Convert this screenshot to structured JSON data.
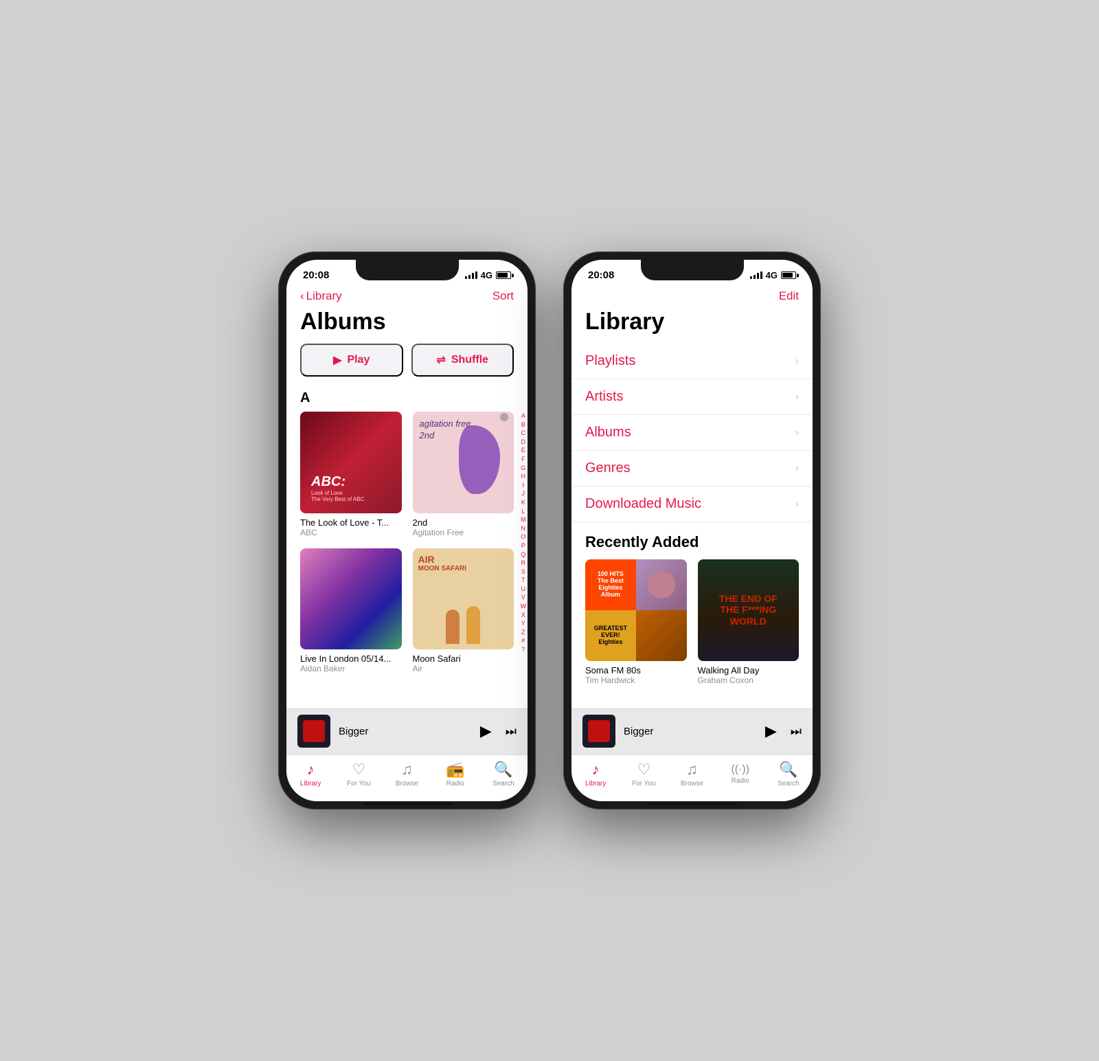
{
  "phone1": {
    "status": {
      "time": "20:08",
      "signal": "4G"
    },
    "nav": {
      "back_label": "Library",
      "action_label": "Sort"
    },
    "title": "Albums",
    "buttons": {
      "play": "Play",
      "shuffle": "Shuffle"
    },
    "section_a": "A",
    "albums": [
      {
        "title": "The Look of Love - T...",
        "artist": "ABC",
        "art_type": "abc"
      },
      {
        "title": "2nd",
        "artist": "Agitation Free",
        "art_type": "agitation"
      },
      {
        "title": "Live In London 05/14...",
        "artist": "Aidan Baker",
        "art_type": "london"
      },
      {
        "title": "Moon Safari",
        "artist": "Air",
        "art_type": "moon"
      }
    ],
    "alphabet": [
      "A",
      "B",
      "C",
      "D",
      "E",
      "F",
      "G",
      "H",
      "I",
      "J",
      "K",
      "L",
      "M",
      "N",
      "O",
      "P",
      "Q",
      "R",
      "S",
      "T",
      "U",
      "V",
      "W",
      "X",
      "Y",
      "Z",
      "#",
      "?"
    ],
    "now_playing": {
      "title": "Bigger",
      "art_type": "bigger"
    },
    "tabs": [
      {
        "label": "Library",
        "icon": "music-note",
        "active": true
      },
      {
        "label": "For You",
        "icon": "heart",
        "active": false
      },
      {
        "label": "Browse",
        "icon": "music",
        "active": false
      },
      {
        "label": "Radio",
        "icon": "radio",
        "active": false
      },
      {
        "label": "Search",
        "icon": "search",
        "active": false
      }
    ]
  },
  "phone2": {
    "status": {
      "time": "20:08",
      "signal": "4G"
    },
    "nav": {
      "action_label": "Edit"
    },
    "title": "Library",
    "library_items": [
      {
        "label": "Playlists"
      },
      {
        "label": "Artists"
      },
      {
        "label": "Albums"
      },
      {
        "label": "Genres"
      },
      {
        "label": "Downloaded Music"
      }
    ],
    "recently_added_heading": "Recently Added",
    "recently_added": [
      {
        "title": "Soma FM 80s",
        "artist": "Tim Hardwick",
        "art_type": "eighties"
      },
      {
        "title": "Walking All Day",
        "artist": "Graham Coxon",
        "art_type": "walking"
      }
    ],
    "now_playing": {
      "title": "Bigger",
      "art_type": "bigger"
    },
    "tabs": [
      {
        "label": "Library",
        "icon": "music-note",
        "active": true
      },
      {
        "label": "For You",
        "icon": "heart",
        "active": false
      },
      {
        "label": "Browse",
        "icon": "music",
        "active": false
      },
      {
        "label": "Radio",
        "icon": "radio",
        "active": false
      },
      {
        "label": "Search",
        "icon": "search",
        "active": false
      }
    ]
  }
}
